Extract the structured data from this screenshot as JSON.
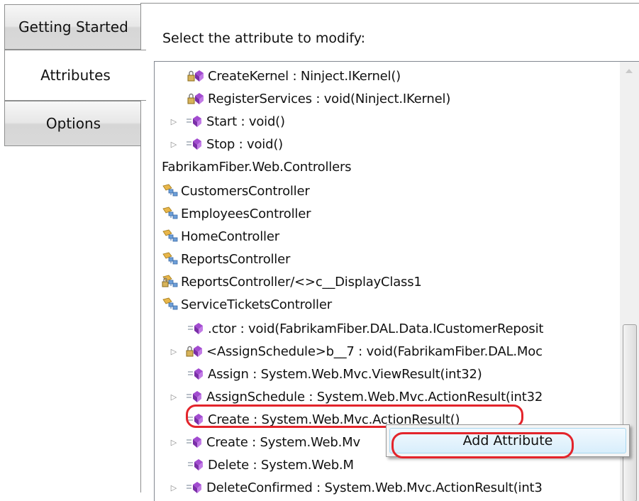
{
  "tabs": [
    {
      "label": "Getting Started"
    },
    {
      "label": "Attributes"
    },
    {
      "label": "Options"
    }
  ],
  "panel": {
    "prompt": "Select the attribute to modify:"
  },
  "tree": {
    "rows": [
      {
        "text": "CreateKernel : Ninject.IKernel()",
        "icon": "method-lock-icon",
        "expander": false
      },
      {
        "text": "RegisterServices : void(Ninject.IKernel)",
        "icon": "method-lock-icon",
        "expander": false
      },
      {
        "text": "Start : void()",
        "icon": "method-icon",
        "expander": true
      },
      {
        "text": "Stop : void()",
        "icon": "method-icon",
        "expander": true
      },
      {
        "text": "FabrikamFiber.Web.Controllers",
        "icon": "",
        "expander": false
      },
      {
        "text": "CustomersController",
        "icon": "class-icon",
        "expander": false
      },
      {
        "text": "EmployeesController",
        "icon": "class-icon",
        "expander": false
      },
      {
        "text": "HomeController",
        "icon": "class-icon",
        "expander": false
      },
      {
        "text": "ReportsController",
        "icon": "class-icon",
        "expander": false
      },
      {
        "text": "ReportsController/<>c__DisplayClass1",
        "icon": "class-lock-icon",
        "expander": false
      },
      {
        "text": "ServiceTicketsController",
        "icon": "class-icon",
        "expander": false
      },
      {
        "text": ".ctor : void(FabrikamFiber.DAL.Data.ICustomerReposit",
        "icon": "method-icon",
        "expander": false
      },
      {
        "text": "<AssignSchedule>b__7 : void(FabrikamFiber.DAL.Moc",
        "icon": "method-lock-icon",
        "expander": true
      },
      {
        "text": "Assign : System.Web.Mvc.ViewResult(int32)",
        "icon": "method-icon",
        "expander": false
      },
      {
        "text": "AssignSchedule : System.Web.Mvc.ActionResult(int32",
        "icon": "method-icon",
        "expander": true
      },
      {
        "text": "Create : System.Web.Mvc.ActionResult()",
        "icon": "method-icon",
        "expander": false
      },
      {
        "text": "Create : System.Web.Mv",
        "icon": "method-icon",
        "expander": true
      },
      {
        "text": "Delete : System.Web.M",
        "icon": "method-icon",
        "expander": false
      },
      {
        "text": "DeleteConfirmed : System.Web.Mvc.ActionResult(int3",
        "icon": "method-icon",
        "expander": true
      }
    ]
  },
  "context_menu": {
    "items": [
      {
        "label": "Add Attribute"
      }
    ]
  },
  "colors": {
    "highlight": "#e3242b",
    "method": "#a24bd0",
    "class": "#e8b64a"
  }
}
